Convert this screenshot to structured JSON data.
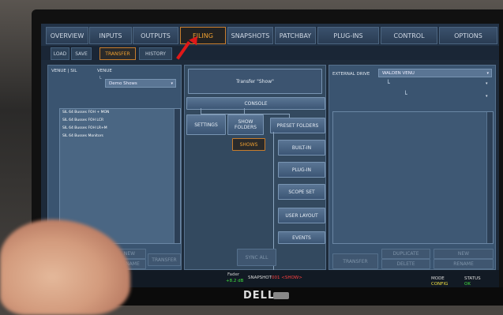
{
  "main_tabs": [
    {
      "label": "OVERVIEW"
    },
    {
      "label": "INPUTS"
    },
    {
      "label": "OUTPUTS"
    },
    {
      "label": "FILING"
    },
    {
      "label": "SNAPSHOTS"
    },
    {
      "label": "PATCHBAY"
    },
    {
      "label": "PLUG-INS"
    },
    {
      "label": "CONTROL"
    },
    {
      "label": "OPTIONS"
    }
  ],
  "sub_tabs": [
    {
      "label": "LOAD"
    },
    {
      "label": "SAVE"
    },
    {
      "label": "TRANSFER"
    },
    {
      "label": "HISTORY"
    }
  ],
  "left_panel": {
    "venue_label": "VENUE | SIL",
    "venue_header": "VENUE",
    "venue_dropdown": "Demo Shows",
    "shows": [
      "SIL 64 Busses FOH + MON",
      "SIL 64 Busses FOH LCR",
      "SIL 64 Busses FOH LR+M",
      "SIL 64 Busses Monitors"
    ],
    "buttons": {
      "new": "NEW",
      "rename": "RENAME",
      "transfer": "TRANSFER"
    }
  },
  "center_panel": {
    "header": "Transfer \"Show\"",
    "console": "CONSOLE",
    "settings": "SETTINGS",
    "show_folders": "SHOW FOLDERS",
    "shows": "SHOWS",
    "preset_folders": "PRESET FOLDERS",
    "built_in": "BUILT-IN",
    "plug_in": "PLUG-IN",
    "scope_set": "SCOPE SET",
    "user_layout": "USER LAYOUT",
    "events": "EVENTS",
    "sync_all": "SYNC ALL"
  },
  "right_panel": {
    "external_drive_label": "EXTERNAL DRIVE",
    "drive_dropdown": "WALDEN VENU",
    "buttons": {
      "transfer": "TRANSFER",
      "duplicate": "DUPLICATE",
      "delete": "DELETE",
      "new": "NEW",
      "rename": "RENAME"
    }
  },
  "status_bar": {
    "fader_label": "Fader",
    "fader_value": "+8.2 dB",
    "snapshot_label": "SNAPSHOT",
    "snapshot_value": "001 <SHOW>",
    "mode_label": "MODE",
    "mode_value": "CONFIG",
    "status_label": "STATUS",
    "status_value": "OK"
  },
  "monitor_brand": "DELL",
  "colors": {
    "accent_orange": "#f0a030",
    "panel_blue": "#3a5470",
    "status_red": "#ff4040",
    "status_green": "#40e040"
  }
}
